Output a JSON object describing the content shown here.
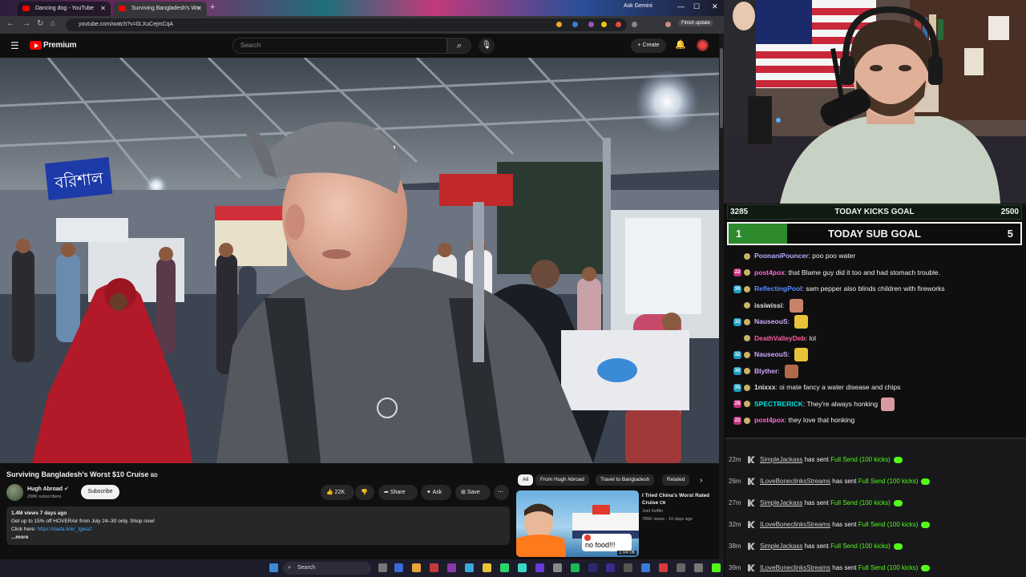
{
  "browser": {
    "tabs": [
      {
        "title": "Dancing dog - YouTube"
      },
      {
        "title": "Surviving Bangladesh's Wo"
      }
    ],
    "ask_gemini": "Ask Gemini",
    "url": "youtube.com/watch?v=0LXuCejmCqA",
    "finish_update": "Finish update"
  },
  "youtube": {
    "logo_text": "Premium",
    "search_placeholder": "Search",
    "create_label": "Create",
    "video": {
      "title": "Surviving Bangladesh's Worst $10 Cruise",
      "title_flag": "BD",
      "channel": "Hugh Abroad",
      "subscribers": "298K subscribers",
      "subscribe_label": "Subscribe",
      "likes": "22K",
      "share_label": "Share",
      "ask_label": "Ask",
      "save_label": "Save",
      "views_line": "1.4M views  7 days ago",
      "desc_line1": "Get up to 15% off HOVERAir from July 24–30 only. Shop now!",
      "desc_line2_prefix": "Click here: ",
      "desc_link": "https://dada.link/_tgwa2",
      "more_label": "...more",
      "sign_text": "বরিশাল"
    },
    "chips": [
      "All",
      "From Hugh Abroad",
      "Travel to Bangladesh",
      "Related"
    ],
    "recommended": {
      "title": "I Tried China's Worst Rated Cruise",
      "title_flag": "CN",
      "channel": "Joel Griffin",
      "meta": "786K views · 10 days ago",
      "duration": "1:04:06",
      "thumb_text": "no food!!!"
    }
  },
  "taskbar": {
    "search_placeholder": "Search"
  },
  "stream": {
    "kicks_goal": {
      "current": "3285",
      "label": "TODAY KICKS GOAL",
      "target": "2500"
    },
    "sub_goal": {
      "current": "1",
      "label": "TODAY SUB GOAL",
      "target": "5",
      "progress": 0.2
    },
    "chat": [
      {
        "user": "PoonaniPouncer",
        "color": "#b0b0ff",
        "badge": "",
        "text": "poo poo water"
      },
      {
        "user": "post4pox",
        "color": "#ff69d4",
        "badge": "22",
        "badge_color": "#c03080",
        "text": "that Blame guy did it too and had stomach trouble."
      },
      {
        "user": "ReflectingPool",
        "color": "#5b8cff",
        "badge": "39",
        "badge_color": "#1e9ec0",
        "text": "sam pepper also blinds children with fireworks"
      },
      {
        "user": "issiwissi",
        "color": "#e0e0e0",
        "badge": "",
        "text": "",
        "emote": "#c9826a"
      },
      {
        "user": "NauseouS",
        "color": "#d2a8ff",
        "badge": "32",
        "badge_color": "#1e9ec0",
        "text": "",
        "emote": "#e8c23a"
      },
      {
        "user": "DeathValleyDeb",
        "color": "#ff5fa0",
        "badge": "",
        "text": "lol"
      },
      {
        "user": "NauseouS",
        "color": "#d2a8ff",
        "badge": "32",
        "badge_color": "#1e9ec0",
        "text": "",
        "emote": "#e8c23a"
      },
      {
        "user": "Blyther",
        "color": "#d2a8ff",
        "badge": "30",
        "badge_color": "#1e9ec0",
        "text": "",
        "emote": "#b06a4a"
      },
      {
        "user": "1nixxx",
        "color": "#e0e0e0",
        "badge": "35",
        "badge_color": "#1e9ec0",
        "text": "oi mate fancy a water disease and chips"
      },
      {
        "user": "SPECTRERICK",
        "color": "#00e0e0",
        "badge": "28",
        "badge_color": "#c03080",
        "text": "They're always honking",
        "emote": "#d89aa0"
      },
      {
        "user": "post4pox",
        "color": "#ff69d4",
        "badge": "22",
        "badge_color": "#c03080",
        "text": "they love that honking"
      }
    ],
    "events": [
      {
        "time": "22m",
        "user": "SimpleJackass",
        "text": "has sent",
        "gift": "Full Send (100 kicks)"
      },
      {
        "time": "26m",
        "user": "ILoveBoneclinksStreams",
        "text": "has sent",
        "gift": "Full Send (100 kicks)"
      },
      {
        "time": "27m",
        "user": "SimpleJackass",
        "text": "has sent",
        "gift": "Full Send (100 kicks)"
      },
      {
        "time": "32m",
        "user": "ILoveBoneclinksStreams",
        "text": "has sent",
        "gift": "Full Send (100 kicks)"
      },
      {
        "time": "38m",
        "user": "SimpleJackass",
        "text": "has sent",
        "gift": "Full Send (100 kicks)"
      },
      {
        "time": "39m",
        "user": "ILoveBoneclinksStreams",
        "text": "has sent",
        "gift": "Full Send (100 kicks)"
      }
    ]
  },
  "colors": {
    "youtube_red": "#ff0000",
    "kick_green": "#53fc18",
    "goal_green": "#2d8a2d"
  }
}
